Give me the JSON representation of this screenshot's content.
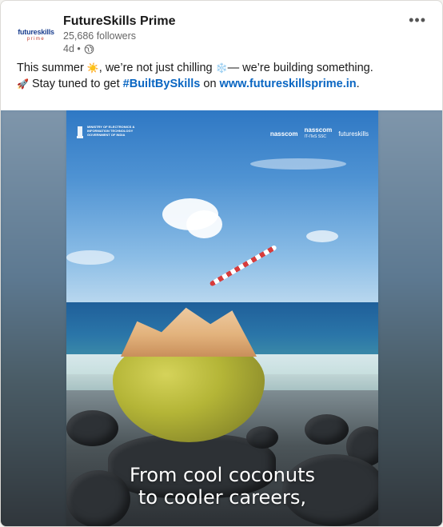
{
  "post": {
    "company_name": "FutureSkills Prime",
    "followers": "25,686 followers",
    "age": "4d •",
    "more_label": "•••",
    "logo_text_1": "futureskills",
    "logo_text_2": "prime",
    "text_line1_a": "This summer ",
    "text_line1_emoji1": "☀️",
    "text_line1_b": ", we’re not just chilling ",
    "text_line1_emoji2": "❄️",
    "text_line1_c": "— we’re building something.",
    "text_line2_emoji": "🚀",
    "text_line2_a": " Stay tuned to get ",
    "hashtag": "#BuiltBySkills",
    "text_line2_b": " on ",
    "link": "www.futureskillsprime.in",
    "text_line2_c": "."
  },
  "image": {
    "gov_text": "MINISTRY OF ELECTRONICS & INFORMATION TECHNOLOGY GOVERNMENT OF INDIA",
    "partner_1": "nasscom",
    "partner_2": "nasscom",
    "partner_2_sub": "IT-ITeS SSC",
    "partner_3": "futureskills",
    "headline_line1": "From cool coconuts",
    "headline_line2": "to cooler careers,"
  },
  "colors": {
    "link": "#0a66c2",
    "text": "#191919",
    "muted": "#666666"
  },
  "icons": {
    "visibility": "globe-icon",
    "more": "more-options-icon"
  }
}
